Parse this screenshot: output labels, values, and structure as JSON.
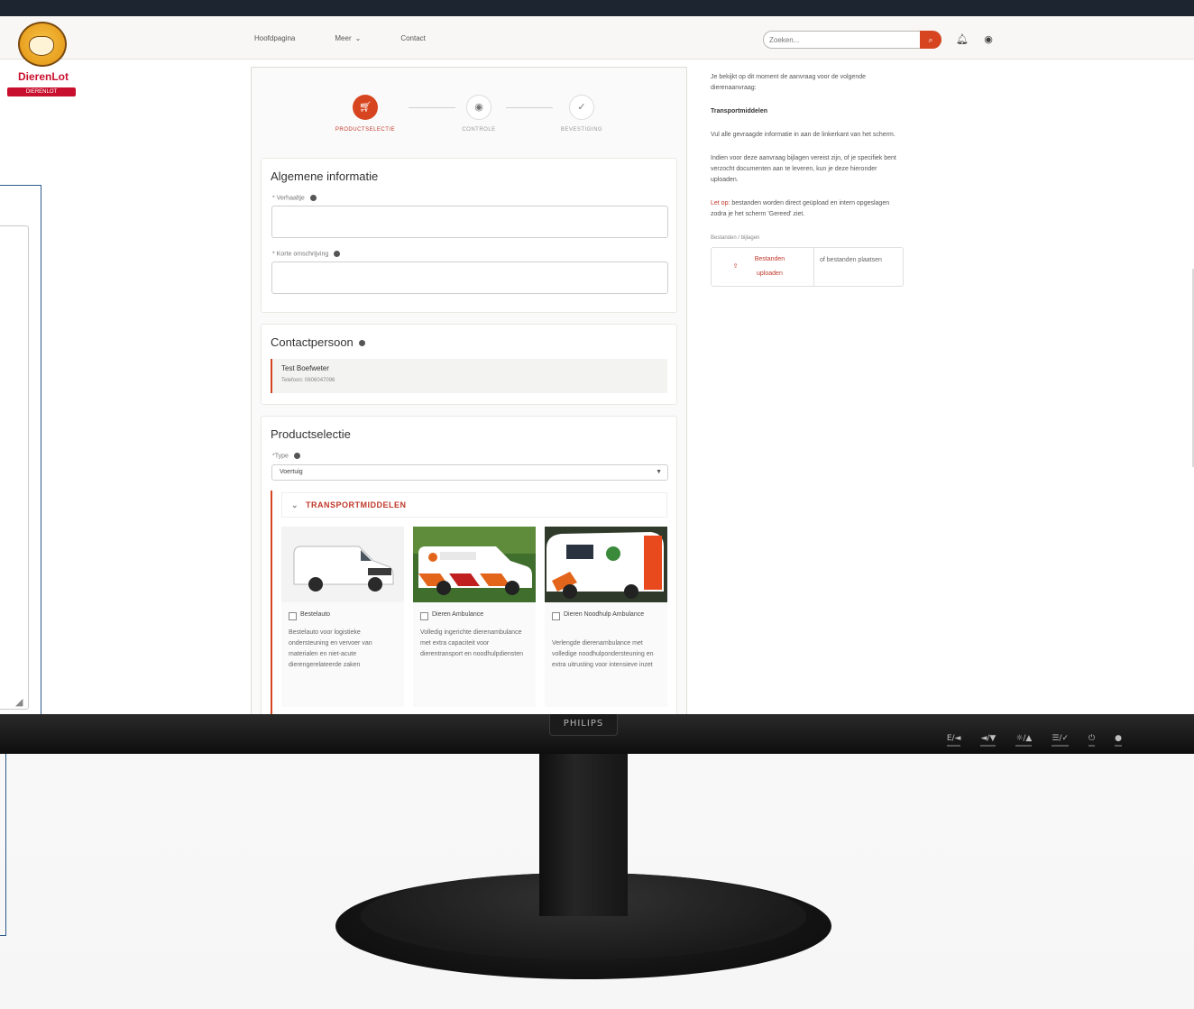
{
  "monitor": {
    "brand": "PHILIPS",
    "buttons": [
      "E/◄",
      "◄/▼",
      "☼/▲",
      "☰/✓",
      "⏻",
      "●"
    ]
  },
  "header": {
    "logo_name": "DierenLot",
    "logo_tagline": "DIERENLOT",
    "nav": [
      "Hoofdpagina",
      "Meer",
      "Contact"
    ],
    "search_placeholder": "Zoeken..."
  },
  "stepper": {
    "steps": [
      {
        "label": "PRODUCTSELECTIE",
        "state": "active",
        "icon": "cart-icon"
      },
      {
        "label": "CONTROLE",
        "state": "inactive",
        "icon": "eye-icon"
      },
      {
        "label": "BEVESTIGING",
        "state": "inactive",
        "icon": "check-icon"
      }
    ]
  },
  "general": {
    "title": "Algemene informatie",
    "field1_label": "* Verhaaltje",
    "field2_label": "* Korte omschrijving"
  },
  "contact": {
    "title": "Contactpersoon",
    "name": "Test Boefweter",
    "phone": "Telefoon: 0606047096"
  },
  "product": {
    "title": "Productselectie",
    "type_label": "*Type",
    "type_value": "Voertuig",
    "accordion_title": "TRANSPORTMIDDELEN",
    "items": [
      {
        "name": "Bestelauto",
        "desc": "Bestelauto voor logistieke ondersteuning en vervoer van materialen en niet-acute dierengerelateerde zaken"
      },
      {
        "name": "Dieren Ambulance",
        "desc": "Volledig ingerichte dierenambulance met extra capaciteit voor dierentransport en noodhulpdiensten"
      },
      {
        "name": "Dieren Noodhulp Ambulance",
        "desc": "Verlengde dierenambulance met volledige noodhulpondersteuning en extra uitrusting voor intensieve inzet"
      }
    ]
  },
  "sidebar": {
    "intro": "Je bekijkt op dit moment de aanvraag voor de volgende dierenaanvraag:",
    "heading": "Transportmiddelen",
    "p1": "Vul alle gevraagde informatie in aan de linkerkant van het scherm.",
    "p2": "Indien voor deze aanvraag bijlagen vereist zijn, of je specifiek bent verzocht documenten aan te leveren, kun je deze hieronder uploaden.",
    "note_prefix": "Let op:",
    "note_text": " bestanden worden direct geüpload en intern opgeslagen zodra je het scherm 'Gereed' ziet.",
    "upload_label": "Bestanden / bijlagen",
    "upload_btn": "Bestanden uploaden",
    "upload_drop": "of bestanden plaatsen"
  },
  "colors": {
    "accent": "#d6451f",
    "brand_red": "#c8102e",
    "bezel": "#1d2630"
  }
}
